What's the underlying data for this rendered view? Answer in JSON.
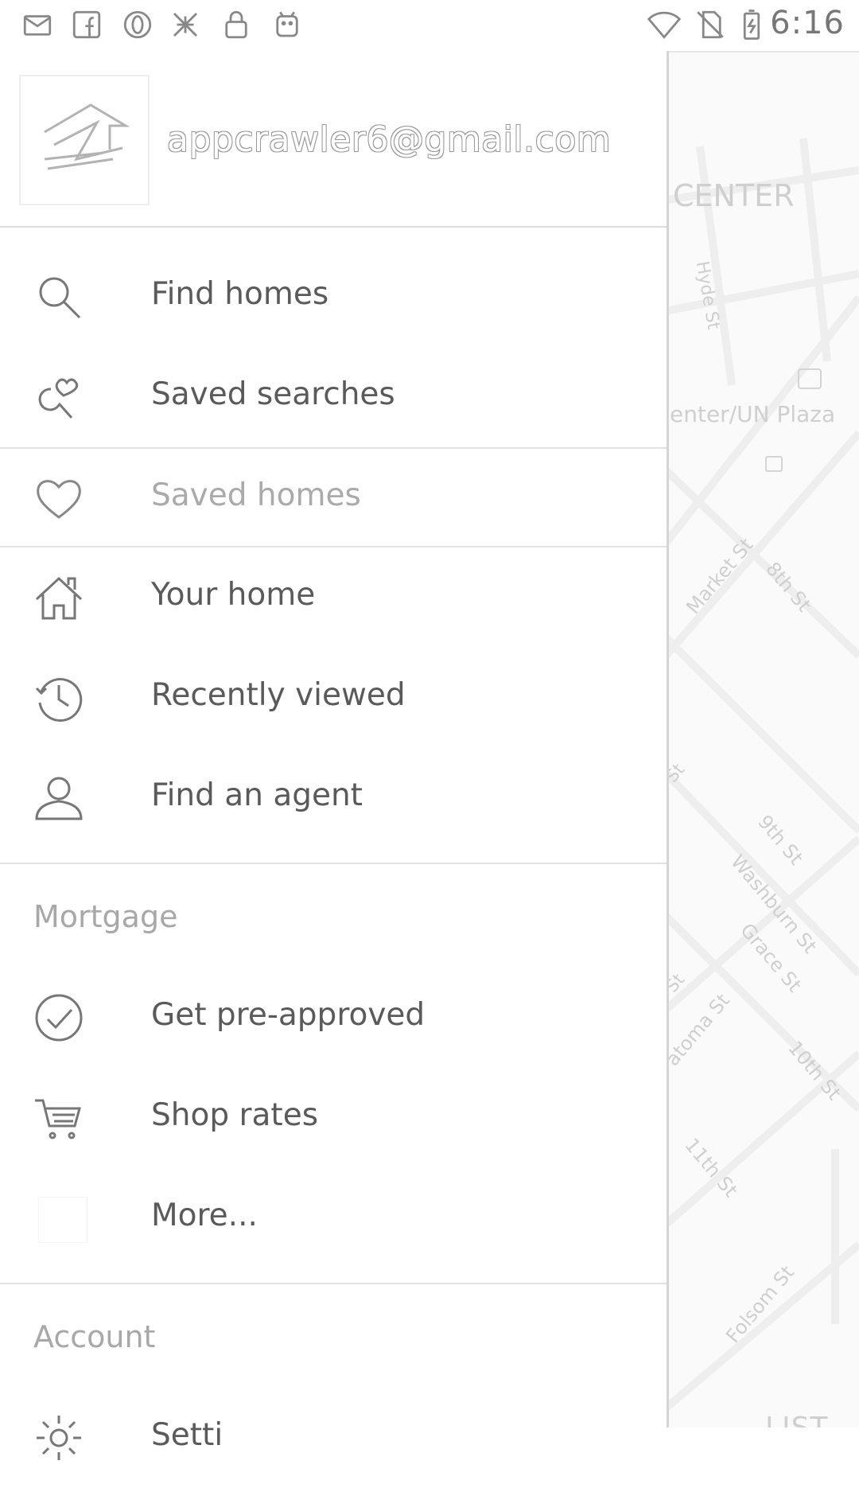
{
  "status_bar": {
    "time": "6:16",
    "left_icons": [
      "email-icon",
      "facebook-icon",
      "opera-icon",
      "app-icon",
      "lock-icon",
      "android-icon"
    ],
    "right_icons": [
      "wifi-icon",
      "no-sim-icon",
      "battery-charging-icon"
    ]
  },
  "drawer": {
    "account_email": "appcrawler6@gmail.com",
    "items": [
      {
        "label": "Find homes",
        "icon": "search-icon"
      },
      {
        "label": "Saved searches",
        "icon": "saved-search-icon"
      },
      {
        "label": "Saved homes",
        "icon": "heart-icon"
      },
      {
        "label": "Your home",
        "icon": "house-icon"
      },
      {
        "label": "Recently viewed",
        "icon": "history-icon"
      },
      {
        "label": "Find an agent",
        "icon": "person-icon"
      }
    ],
    "mortgage": {
      "header": "Mortgage",
      "items": [
        {
          "label": "Get pre-approved",
          "icon": "check-circle-icon"
        },
        {
          "label": "Shop rates",
          "icon": "cart-icon"
        },
        {
          "label": "More...",
          "icon": ""
        }
      ]
    },
    "account": {
      "header": "Account",
      "items": [
        {
          "label": "Setti",
          "icon": "gear-icon"
        }
      ]
    }
  },
  "map": {
    "labels": [
      "CENTER",
      "Hyde St",
      "enter/UN Plaza",
      "Market St",
      "8th St",
      "St",
      "9th St",
      "Washburn St",
      "Grace St",
      "St",
      "atoma St",
      "10th St",
      "11th St",
      "Folsom St"
    ],
    "list_button": "LIST"
  }
}
